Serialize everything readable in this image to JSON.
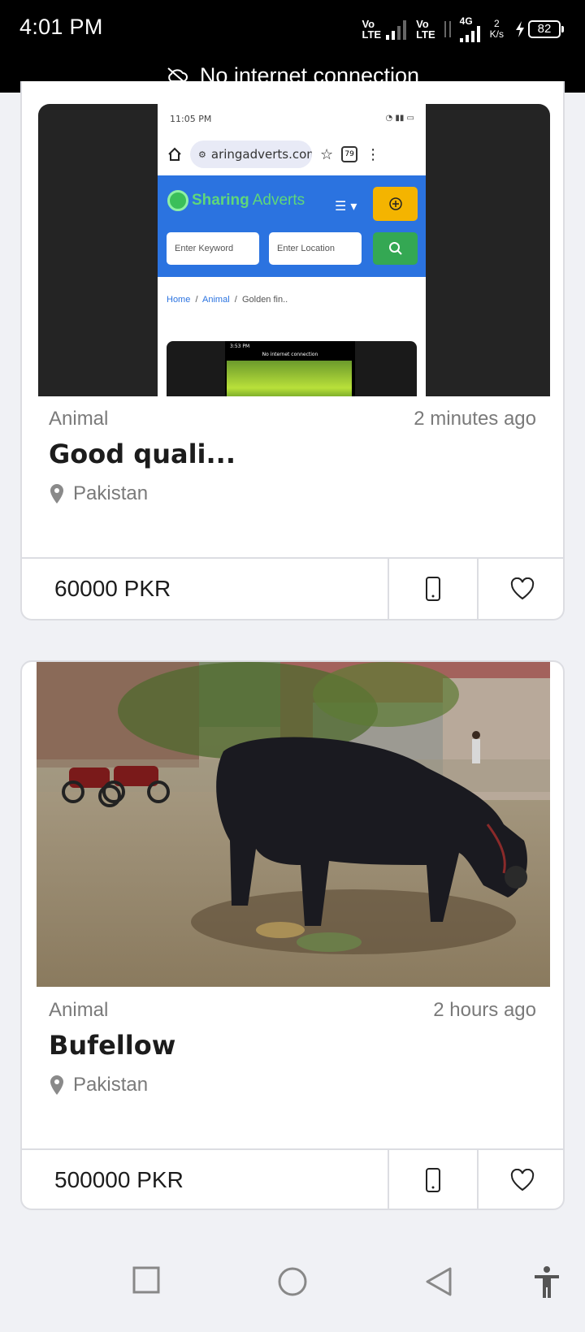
{
  "status_bar": {
    "time": "4:01 PM",
    "sim1": [
      "Vo",
      "LTE"
    ],
    "sim2": [
      "Vo",
      "LTE"
    ],
    "net_type": "4G",
    "speed_value": "2",
    "speed_unit": "K/s",
    "battery": "82"
  },
  "offline_banner": {
    "text": "No internet connection"
  },
  "embedded_screenshot": {
    "time": "11:05 PM",
    "url": "aringadverts.com",
    "tab_count": "79",
    "logo_first": "Sharing",
    "logo_second": "Adverts",
    "keyword_placeholder": "Enter Keyword",
    "location_placeholder": "Enter Location",
    "breadcrumb": [
      "Home",
      "Animal",
      "Golden fin.."
    ],
    "inner_time": "3:53 PM",
    "inner_banner": "No internet connection"
  },
  "listings": [
    {
      "category": "Animal",
      "time": "2 minutes ago",
      "title": "Good quali...",
      "location": "Pakistan",
      "price": "60000 PKR"
    },
    {
      "category": "Animal",
      "time": "2 hours ago",
      "title": "Bufellow",
      "location": "Pakistan",
      "price": "500000 PKR"
    }
  ],
  "colors": {
    "accent_blue": "#2b73e0",
    "add_yellow": "#f4b400",
    "search_green": "#34a853",
    "text_dark": "#1c1c1c",
    "text_muted": "#7a7a7a"
  },
  "icons": [
    "cloud-off-icon",
    "phone-icon",
    "heart-icon",
    "location-pin-icon",
    "recents-icon",
    "home-icon",
    "back-icon",
    "accessibility-icon"
  ]
}
